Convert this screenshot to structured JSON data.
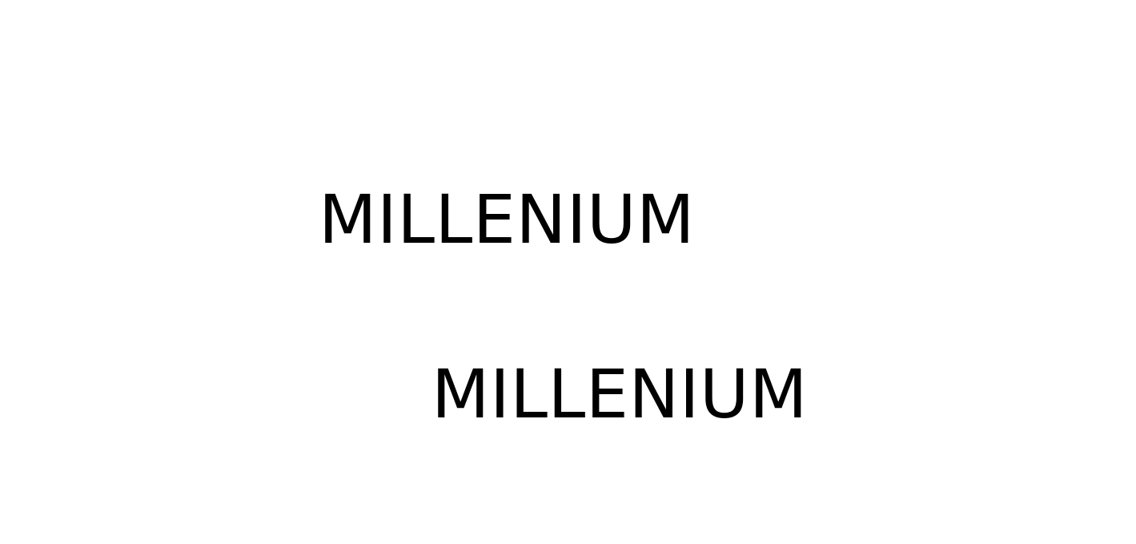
{
  "words": [
    {
      "text": "MILLENIUM",
      "color": "#000000"
    },
    {
      "text": "MILLENIUM",
      "color": "#000000"
    }
  ],
  "background_color": "#ffffff"
}
